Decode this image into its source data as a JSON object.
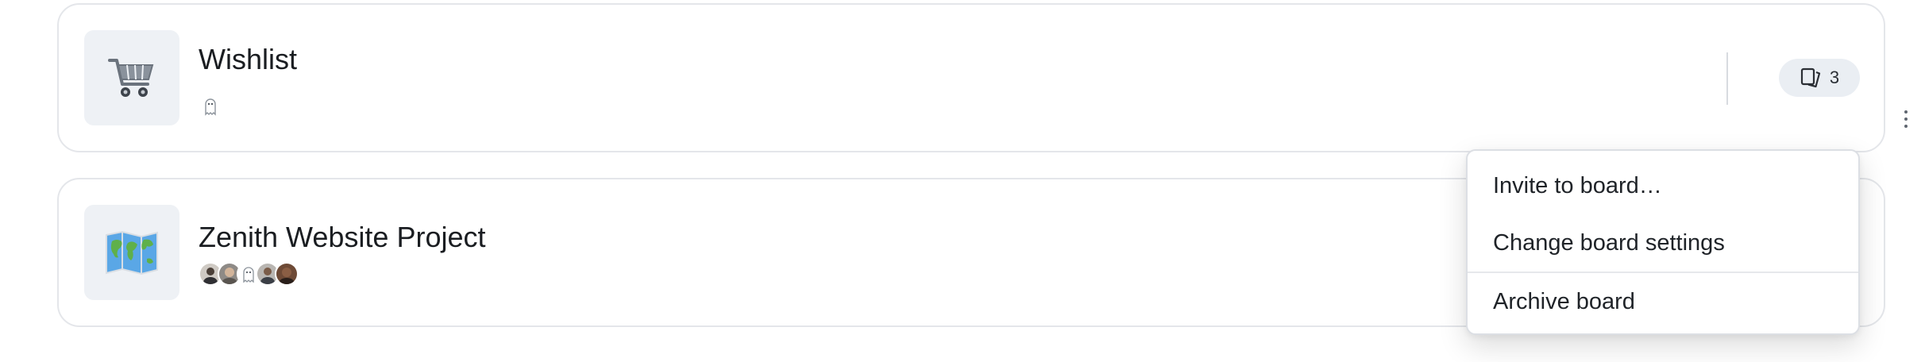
{
  "boards": [
    {
      "title": "Wishlist",
      "icon": "shopping-cart-icon",
      "owners": [
        "ghost-avatar"
      ],
      "card_count": "3"
    },
    {
      "title": "Zenith Website Project",
      "icon": "world-map-icon",
      "owners": [
        "person-avatar-1",
        "person-avatar-2",
        "ghost-avatar",
        "person-avatar-3",
        "person-avatar-4"
      ]
    }
  ],
  "menu": {
    "items": [
      "Invite to board…",
      "Change board settings",
      "Archive board"
    ]
  },
  "colors": {
    "card_border": "#e4e6ea",
    "thumb_bg": "#eef1f5",
    "pill_bg": "#eaeef3"
  }
}
